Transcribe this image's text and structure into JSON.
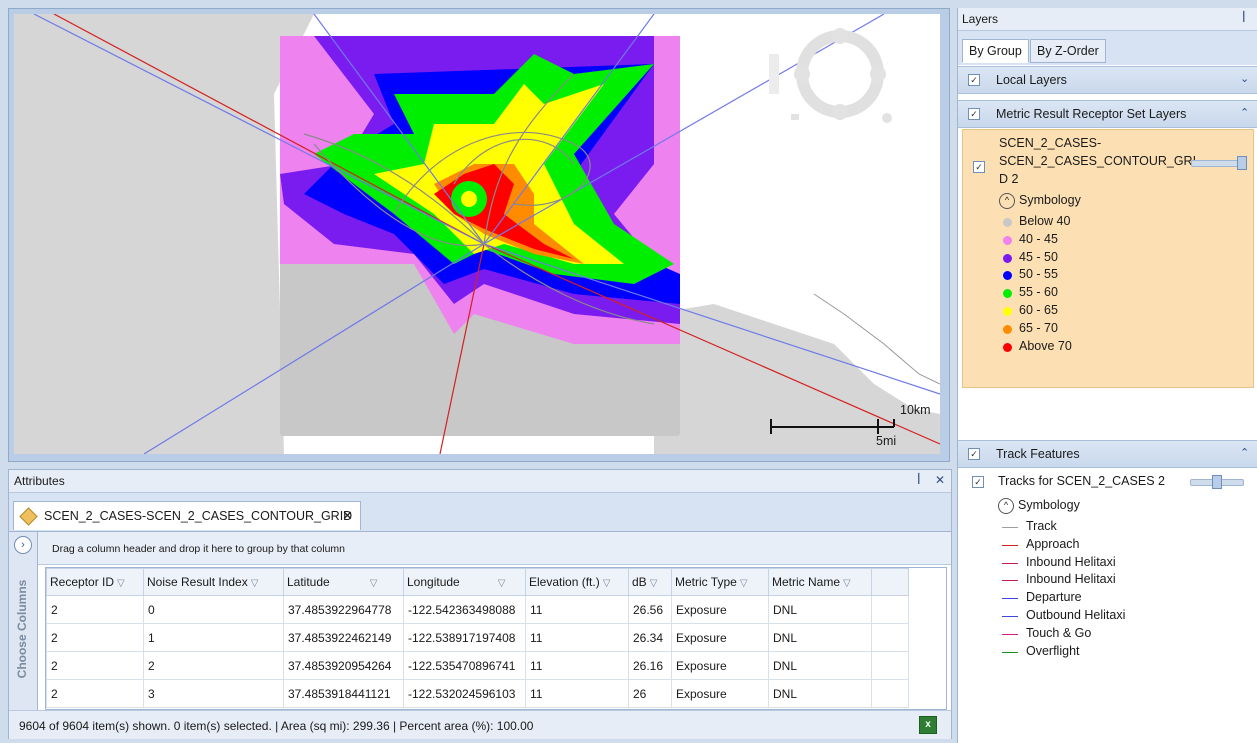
{
  "map": {
    "scale_km": "10km",
    "scale_mi": "5mi"
  },
  "attributes": {
    "title": "Attributes",
    "pin": "ꟾ",
    "close": "✕",
    "tab_label": "SCEN_2_CASES-SCEN_2_CASES_CONTOUR_GRID",
    "tab_close": "✕",
    "choose_columns": "Choose Columns",
    "group_hint": "Drag a column header and drop it here to group by that column",
    "columns": [
      "Receptor ID",
      "Noise Result Index",
      "Latitude",
      "Longitude",
      "Elevation (ft.)",
      "dB",
      "Metric Type",
      "Metric Name"
    ],
    "rows": [
      [
        "2",
        "0",
        "37.4853922964778",
        "-122.542363498088",
        "11",
        "26.56",
        "Exposure",
        "DNL"
      ],
      [
        "2",
        "1",
        "37.4853922462149",
        "-122.538917197408",
        "11",
        "26.34",
        "Exposure",
        "DNL"
      ],
      [
        "2",
        "2",
        "37.4853920954264",
        "-122.535470896741",
        "11",
        "26.16",
        "Exposure",
        "DNL"
      ],
      [
        "2",
        "3",
        "37.4853918441121",
        "-122.532024596103",
        "11",
        "26",
        "Exposure",
        "DNL"
      ]
    ],
    "status": "9604 of 9604 item(s) shown. 0 item(s) selected.  |  Area (sq mi):  299.36  |  Percent area (%):  100.00"
  },
  "layers": {
    "title": "Layers",
    "pin": "ꟾ",
    "tabs": [
      "By Group",
      "By Z-Order"
    ],
    "active_tab": "By Group",
    "sections": {
      "local": "Local Layers",
      "metric": "Metric Result Receptor Set Layers",
      "track": "Track Features"
    },
    "receptor_layer": {
      "name_line1": "SCEN_2_CASES-",
      "name_line2": "SCEN_2_CASES_CONTOUR_GRI",
      "name_line3": "D 2",
      "symbology": "Symbology",
      "legend": [
        {
          "label": "Below 40",
          "color": "#c8c8c8"
        },
        {
          "label": "40 - 45",
          "color": "#ee82ee"
        },
        {
          "label": "45 - 50",
          "color": "#7a1cf0"
        },
        {
          "label": "50 - 55",
          "color": "#0000ff"
        },
        {
          "label": "55 - 60",
          "color": "#00ee00"
        },
        {
          "label": "60 - 65",
          "color": "#ffff00"
        },
        {
          "label": "65 - 70",
          "color": "#ff8c00"
        },
        {
          "label": "Above 70",
          "color": "#ff0000"
        }
      ]
    },
    "track_layer": {
      "name": "Tracks for SCEN_2_CASES 2",
      "symbology": "Symbology",
      "legend": [
        {
          "label": "Track",
          "color": "#9e9e9e"
        },
        {
          "label": "Approach",
          "color": "#d42020"
        },
        {
          "label": "Inbound Helitaxi",
          "color": "#c41a4a"
        },
        {
          "label": "Inbound Helitaxi",
          "color": "#c41a4a"
        },
        {
          "label": "Departure",
          "color": "#3a4ad8"
        },
        {
          "label": "Outbound Helitaxi",
          "color": "#3a4ad8"
        },
        {
          "label": "Touch & Go",
          "color": "#d0208a"
        },
        {
          "label": "Overflight",
          "color": "#208a20"
        }
      ]
    }
  }
}
